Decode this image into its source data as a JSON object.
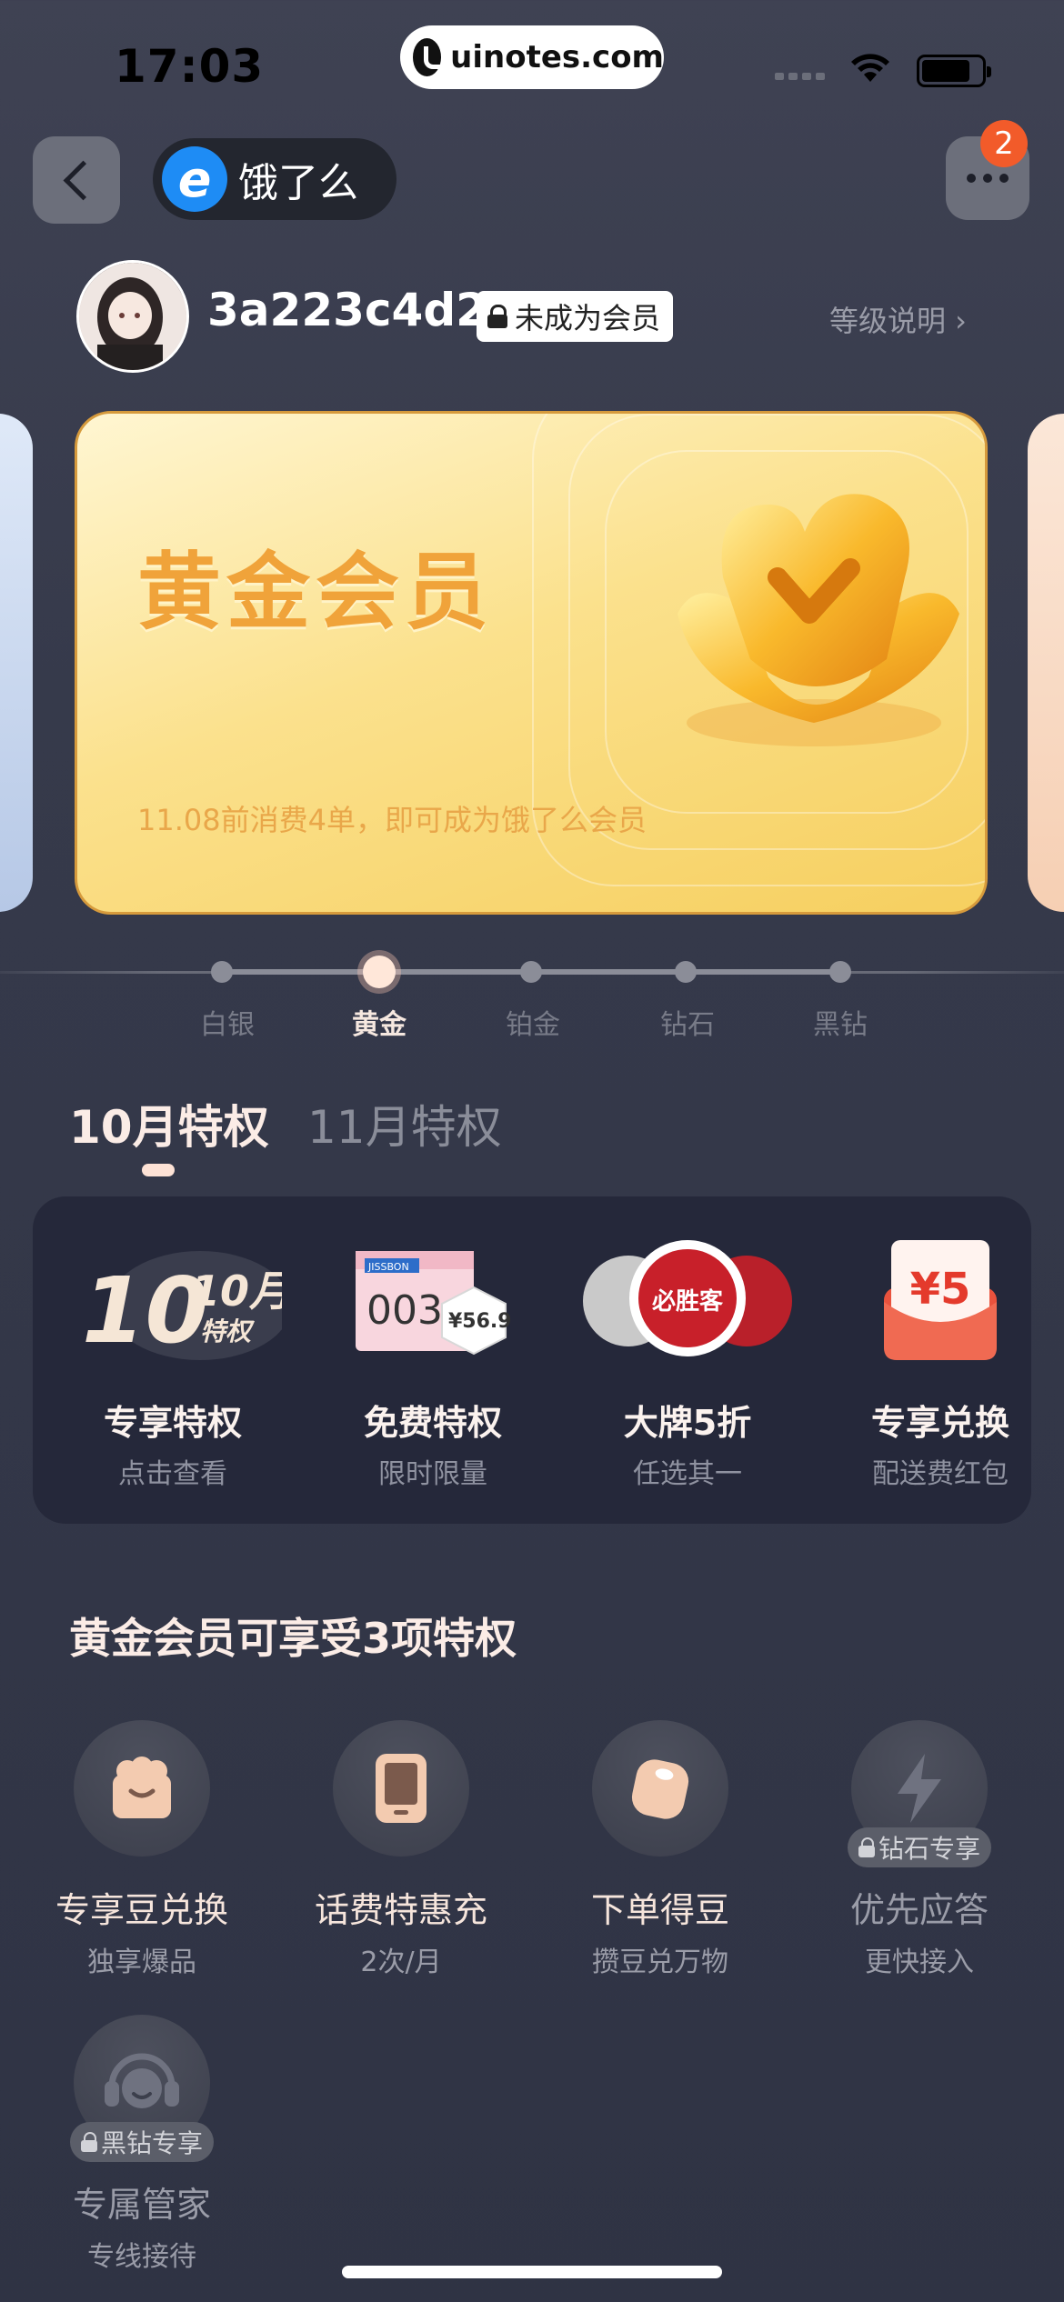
{
  "status_bar": {
    "time": "17:03",
    "watermark": "uinotes.com"
  },
  "nav": {
    "app_logo_glyph": "e",
    "app_name": "饿了么",
    "notification_count": "2"
  },
  "user": {
    "username": "3a223c4d2",
    "member_status": "未成为会员",
    "level_explain": "等级说明 ›"
  },
  "card": {
    "title": "黄金会员",
    "subtitle": "11.08前消费4单，即可成为饿了么会员",
    "colors": {
      "gold": "#f0a33a",
      "gold_light": "#fbe18d"
    }
  },
  "tiers": [
    {
      "label": "白银",
      "active": false
    },
    {
      "label": "黄金",
      "active": true
    },
    {
      "label": "铂金",
      "active": false
    },
    {
      "label": "钻石",
      "active": false
    },
    {
      "label": "黑钻",
      "active": false
    }
  ],
  "month_tabs": [
    {
      "label": "10月特权",
      "active": true
    },
    {
      "label": "11月特权",
      "active": false
    }
  ],
  "privileges": [
    {
      "title": "专享特权",
      "subtitle": "点击查看",
      "badge_month": "10月",
      "badge_text": "特权"
    },
    {
      "title": "免费特权",
      "subtitle": "限时限量",
      "product_brand": "JISSBON",
      "product_name": "003",
      "price": "¥56.9"
    },
    {
      "title": "大牌5折",
      "subtitle": "任选其一",
      "brand": "必胜客"
    },
    {
      "title": "专享兑换",
      "subtitle": "配送费红包",
      "amount": "¥5"
    }
  ],
  "benefits_section": {
    "title": "黄金会员可享受3项特权",
    "items": [
      {
        "title": "专享豆兑换",
        "subtitle": "独享爆品",
        "icon": "gift-bag-icon",
        "locked": false
      },
      {
        "title": "话费特惠充",
        "subtitle": "2次/月",
        "icon": "phone-icon",
        "locked": false
      },
      {
        "title": "下单得豆",
        "subtitle": "攒豆兑万物",
        "icon": "bean-icon",
        "locked": false
      },
      {
        "title": "优先应答",
        "subtitle": "更快接入",
        "icon": "lightning-icon",
        "locked": true,
        "lock_label": "钻石专享"
      },
      {
        "title": "专属管家",
        "subtitle": "专线接待",
        "icon": "headset-icon",
        "locked": true,
        "lock_label": "黑钻专享"
      }
    ]
  }
}
